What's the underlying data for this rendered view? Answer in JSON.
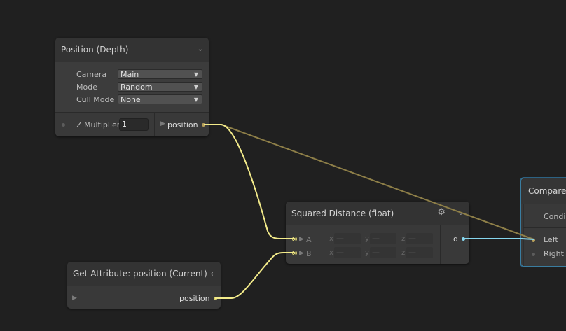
{
  "colors": {
    "wire_position": "#8e7f48",
    "wire_float3": "#f3eb8a",
    "wire_float": "#86d6ee",
    "background": "#202020",
    "node": "#393939",
    "selection": "#3a7da0"
  },
  "position_depth": {
    "title": "Position (Depth)",
    "settings": [
      {
        "label": "Camera",
        "value": "Main"
      },
      {
        "label": "Mode",
        "value": "Random"
      },
      {
        "label": "Cull Mode",
        "value": "None"
      }
    ],
    "input_label": "Z Multiplier",
    "input_value": "1",
    "output_label": "position"
  },
  "get_attribute": {
    "title": "Get Attribute: position (Current)",
    "output_label": "position"
  },
  "squared_distance": {
    "title": "Squared Distance (float)",
    "inputs": [
      {
        "label": "A",
        "x": "—",
        "y": "—",
        "z": "—"
      },
      {
        "label": "B",
        "x": "—",
        "y": "—",
        "z": "—"
      }
    ],
    "axis": {
      "x": "x",
      "y": "y",
      "z": "z"
    },
    "output_label": "d"
  },
  "compare": {
    "title": "Compare",
    "condition_label": "Condi",
    "inputs": [
      {
        "label": "Left"
      },
      {
        "label": "Right"
      }
    ]
  },
  "icons": {
    "collapse": "chevron-down-icon",
    "gear": "gear-icon",
    "port": "triangle-right-icon"
  }
}
